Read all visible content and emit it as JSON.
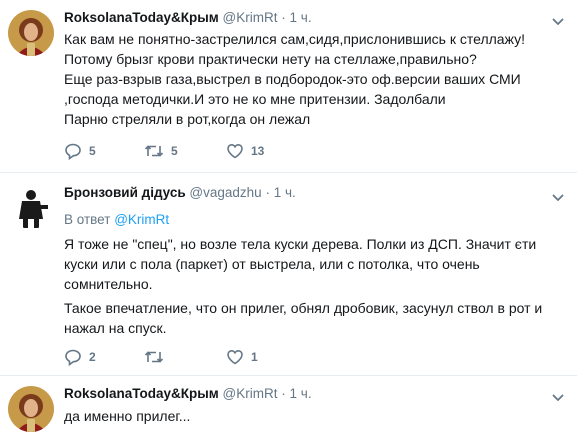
{
  "tweets": [
    {
      "author": "RoksolanaToday&Крым",
      "handle": "@KrimRt",
      "dot": "·",
      "time": "1 ч.",
      "lines": [
        "Как вам не понятно-застрелился сам,сидя,прислонившись к стеллажу!",
        "Потому брызг крови практически нету на стеллаже,правильно?",
        "Еще раз-взрыв газа,выстрел в подбородок-это оф.версии ваших СМИ",
        ",господа методички.И это не ко мне притензии. Задолбали",
        "Парню стреляли в рот,когда он лежал"
      ],
      "replies": "5",
      "retweets": "5",
      "likes": "13"
    },
    {
      "author": "Бронзовий дідусь",
      "handle": "@vagadzhu",
      "dot": "·",
      "time": "1 ч.",
      "reply_prefix": "В ответ",
      "reply_to": "@KrimRt",
      "lines": [
        "Я тоже не \"спец\", но возле тела куски дерева. Полки из ДСП. Значит єти",
        "куски или с пола (паркет) от выстрела, или с потолка, что очень",
        "сомнительно.",
        "Такое впечатление, что он прилег, обнял дробовик, засунул ствол в рот и",
        "нажал на спуск."
      ],
      "replies": "2",
      "retweets": "",
      "likes": "1"
    },
    {
      "author": "RoksolanaToday&Крым",
      "handle": "@KrimRt",
      "dot": "·",
      "time": "1 ч.",
      "lines": [
        "да именно прилег..."
      ]
    }
  ],
  "icons": [
    "reply-icon",
    "retweet-icon",
    "like-icon",
    "caret-down-icon"
  ],
  "colors": {
    "text": "#14171a",
    "secondary": "#657786",
    "link": "#1da1f2",
    "divider": "#e6ecf0"
  }
}
